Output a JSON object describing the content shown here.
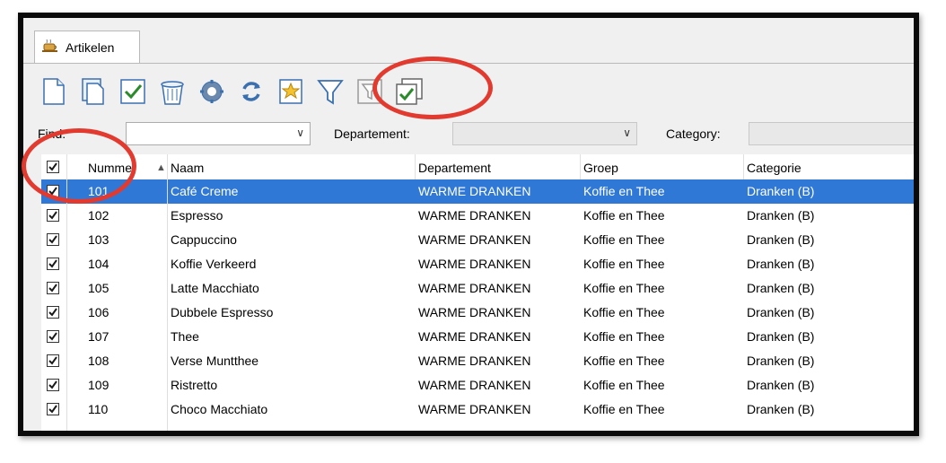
{
  "tab": {
    "label": "Artikelen",
    "icon": "coffee-cup-icon"
  },
  "toolbar": {
    "buttons": [
      {
        "name": "new-document-icon"
      },
      {
        "name": "copy-document-icon"
      },
      {
        "name": "checkmark-icon"
      },
      {
        "name": "trash-icon"
      },
      {
        "name": "settings-icon"
      },
      {
        "name": "refresh-icon"
      },
      {
        "name": "favorite-icon"
      },
      {
        "name": "filter-icon"
      },
      {
        "name": "filter-disabled-icon"
      },
      {
        "name": "copy-checkmark-icon"
      }
    ]
  },
  "filters": {
    "find_label": "Find:",
    "find_value": "",
    "departement_label": "Departement:",
    "departement_value": "",
    "category_label": "Category:",
    "category_value": ""
  },
  "table": {
    "columns": [
      "Nummer",
      "Naam",
      "Departement",
      "Groep",
      "Categorie"
    ],
    "sort_column": "Nummer",
    "rows": [
      {
        "nummer": "101",
        "naam": "Café Creme",
        "departement": "WARME DRANKEN",
        "groep": "Koffie en Thee",
        "categorie": "Dranken (B)",
        "checked": true,
        "selected": true
      },
      {
        "nummer": "102",
        "naam": "Espresso",
        "departement": "WARME DRANKEN",
        "groep": "Koffie en Thee",
        "categorie": "Dranken (B)",
        "checked": true
      },
      {
        "nummer": "103",
        "naam": "Cappuccino",
        "departement": "WARME DRANKEN",
        "groep": "Koffie en Thee",
        "categorie": "Dranken (B)",
        "checked": true
      },
      {
        "nummer": "104",
        "naam": "Koffie Verkeerd",
        "departement": "WARME DRANKEN",
        "groep": "Koffie en Thee",
        "categorie": "Dranken (B)",
        "checked": true
      },
      {
        "nummer": "105",
        "naam": "Latte Macchiato",
        "departement": "WARME DRANKEN",
        "groep": "Koffie en Thee",
        "categorie": "Dranken (B)",
        "checked": true
      },
      {
        "nummer": "106",
        "naam": "Dubbele Espresso",
        "departement": "WARME DRANKEN",
        "groep": "Koffie en Thee",
        "categorie": "Dranken (B)",
        "checked": true
      },
      {
        "nummer": "107",
        "naam": "Thee",
        "departement": "WARME DRANKEN",
        "groep": "Koffie en Thee",
        "categorie": "Dranken (B)",
        "checked": true
      },
      {
        "nummer": "108",
        "naam": "Verse Muntthee",
        "departement": "WARME DRANKEN",
        "groep": "Koffie en Thee",
        "categorie": "Dranken (B)",
        "checked": true
      },
      {
        "nummer": "109",
        "naam": "Ristretto",
        "departement": "WARME DRANKEN",
        "groep": "Koffie en Thee",
        "categorie": "Dranken (B)",
        "checked": true
      },
      {
        "nummer": "110",
        "naam": "Choco Macchiato",
        "departement": "WARME DRANKEN",
        "groep": "Koffie en Thee",
        "categorie": "Dranken (B)",
        "checked": true
      }
    ]
  },
  "colors": {
    "selection": "#3078d6",
    "annotation": "#e23a2e",
    "check": "#2b8a2b"
  }
}
